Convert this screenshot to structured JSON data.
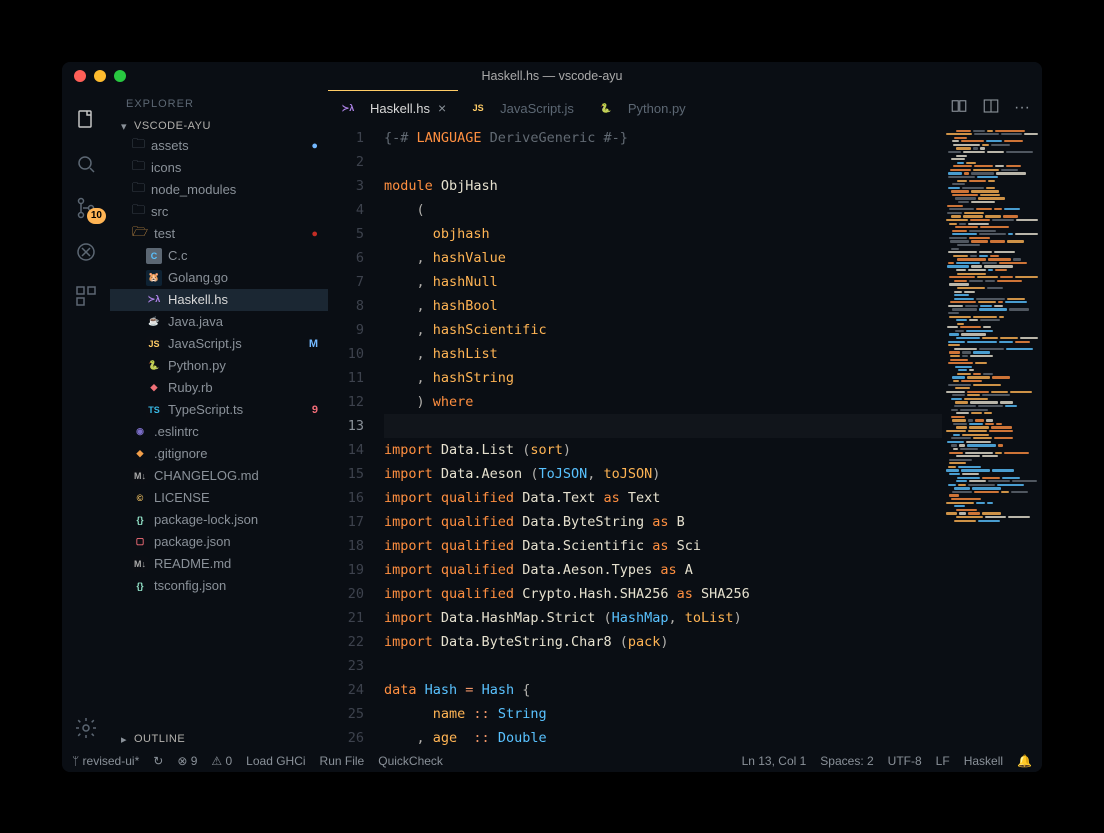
{
  "window": {
    "title": "Haskell.hs — vscode-ayu",
    "traffic_colors": [
      "#ff5f57",
      "#febc2e",
      "#28c840"
    ]
  },
  "activity": {
    "badge_source": "10"
  },
  "sidebar": {
    "title": "EXPLORER",
    "section": "VSCODE-AYU",
    "outline_label": "OUTLINE",
    "items": [
      {
        "kind": "folder",
        "name": "assets",
        "depth": 1,
        "decoration": "●",
        "decColor": "#73b8ff"
      },
      {
        "kind": "folder",
        "name": "icons",
        "depth": 1
      },
      {
        "kind": "folder",
        "name": "node_modules",
        "depth": 1
      },
      {
        "kind": "folder",
        "name": "src",
        "depth": 1
      },
      {
        "kind": "folder",
        "name": "test",
        "depth": 1,
        "open": true,
        "decoration": "●",
        "decColor": "#c42d25",
        "iconColor": "#ffb454"
      },
      {
        "kind": "file",
        "name": "C.c",
        "depth": 2,
        "iconBg": "#5c6773",
        "iconFg": "#59c2ff",
        "iconText": "C"
      },
      {
        "kind": "file",
        "name": "Golang.go",
        "depth": 2,
        "iconBg": "#0e2233",
        "iconFg": "#7fd5ea",
        "iconText": "🐹"
      },
      {
        "kind": "file",
        "name": "Haskell.hs",
        "depth": 2,
        "active": true,
        "iconBg": "transparent",
        "iconFg": "#b084eb",
        "iconText": "≻λ"
      },
      {
        "kind": "file",
        "name": "Java.java",
        "depth": 2,
        "iconBg": "transparent",
        "iconFg": "#e45649",
        "iconText": "☕"
      },
      {
        "kind": "file",
        "name": "JavaScript.js",
        "depth": 2,
        "decoration": "M",
        "decColor": "#73b8ff",
        "iconBg": "#0b0e14",
        "iconFg": "#ffcc66",
        "iconText": "JS"
      },
      {
        "kind": "file",
        "name": "Python.py",
        "depth": 2,
        "iconBg": "transparent",
        "iconFg": "#ffd580",
        "iconText": "🐍"
      },
      {
        "kind": "file",
        "name": "Ruby.rb",
        "depth": 2,
        "iconBg": "transparent",
        "iconFg": "#f07178",
        "iconText": "◆"
      },
      {
        "kind": "file",
        "name": "TypeScript.ts",
        "depth": 2,
        "decoration": "9",
        "decColor": "#f26d78",
        "iconBg": "#0b0e14",
        "iconFg": "#39bae6",
        "iconText": "TS"
      },
      {
        "kind": "file",
        "name": ".eslintrc",
        "depth": 1,
        "iconBg": "transparent",
        "iconFg": "#7b6dc7",
        "iconText": "◉"
      },
      {
        "kind": "file",
        "name": ".gitignore",
        "depth": 1,
        "iconBg": "transparent",
        "iconFg": "#f29e49",
        "iconText": "◆"
      },
      {
        "kind": "file",
        "name": "CHANGELOG.md",
        "depth": 1,
        "iconBg": "#0b0e14",
        "iconFg": "#aaa",
        "iconText": "M↓"
      },
      {
        "kind": "file",
        "name": "LICENSE",
        "depth": 1,
        "iconBg": "transparent",
        "iconFg": "#ffcc66",
        "iconText": "©"
      },
      {
        "kind": "file",
        "name": "package-lock.json",
        "depth": 1,
        "iconBg": "transparent",
        "iconFg": "#95e6cb",
        "iconText": "{}"
      },
      {
        "kind": "file",
        "name": "package.json",
        "depth": 1,
        "iconBg": "transparent",
        "iconFg": "#f26d78",
        "iconText": "▢"
      },
      {
        "kind": "file",
        "name": "README.md",
        "depth": 1,
        "iconBg": "#0b0e14",
        "iconFg": "#aaa",
        "iconText": "M↓"
      },
      {
        "kind": "file",
        "name": "tsconfig.json",
        "depth": 1,
        "iconBg": "transparent",
        "iconFg": "#95e6cb",
        "iconText": "{}"
      }
    ]
  },
  "tabs": [
    {
      "label": "Haskell.hs",
      "active": true,
      "iconText": "≻λ",
      "iconColor": "#b084eb",
      "close": "×"
    },
    {
      "label": "JavaScript.js",
      "iconText": "JS",
      "iconColor": "#ffcc66"
    },
    {
      "label": "Python.py",
      "iconText": "🐍",
      "iconColor": "#ffd580"
    }
  ],
  "code_lines": [
    {
      "n": 1,
      "segs": [
        {
          "t": "{-# ",
          "c": "comment"
        },
        {
          "t": "LANGUAGE",
          "c": "keyword"
        },
        {
          "t": " DeriveGeneric #-}",
          "c": "comment"
        }
      ]
    },
    {
      "n": 2,
      "segs": []
    },
    {
      "n": 3,
      "segs": [
        {
          "t": "module",
          "c": "keyword"
        },
        {
          "t": " ObjHash",
          "c": "module"
        }
      ]
    },
    {
      "n": 4,
      "segs": [
        {
          "t": "    ( ",
          "c": "punct"
        }
      ]
    },
    {
      "n": 5,
      "segs": [
        {
          "t": "      ",
          "c": "punct"
        },
        {
          "t": "objhash",
          "c": "func"
        }
      ]
    },
    {
      "n": 6,
      "segs": [
        {
          "t": "    , ",
          "c": "punct"
        },
        {
          "t": "hashValue",
          "c": "func"
        }
      ]
    },
    {
      "n": 7,
      "segs": [
        {
          "t": "    , ",
          "c": "punct"
        },
        {
          "t": "hashNull",
          "c": "func"
        }
      ]
    },
    {
      "n": 8,
      "segs": [
        {
          "t": "    , ",
          "c": "punct"
        },
        {
          "t": "hashBool",
          "c": "func"
        }
      ]
    },
    {
      "n": 9,
      "segs": [
        {
          "t": "    , ",
          "c": "punct"
        },
        {
          "t": "hashScientific",
          "c": "func"
        }
      ]
    },
    {
      "n": 10,
      "segs": [
        {
          "t": "    , ",
          "c": "punct"
        },
        {
          "t": "hashList",
          "c": "func"
        }
      ]
    },
    {
      "n": 11,
      "segs": [
        {
          "t": "    , ",
          "c": "punct"
        },
        {
          "t": "hashString",
          "c": "func"
        }
      ]
    },
    {
      "n": 12,
      "segs": [
        {
          "t": "    ) ",
          "c": "punct"
        },
        {
          "t": "where",
          "c": "keyword"
        }
      ]
    },
    {
      "n": 13,
      "segs": [],
      "current": true
    },
    {
      "n": 14,
      "segs": [
        {
          "t": "import",
          "c": "keyword"
        },
        {
          "t": " Data.List ",
          "c": "ident"
        },
        {
          "t": "(",
          "c": "punct"
        },
        {
          "t": "sort",
          "c": "func"
        },
        {
          "t": ")",
          "c": "punct"
        }
      ]
    },
    {
      "n": 15,
      "segs": [
        {
          "t": "import",
          "c": "keyword"
        },
        {
          "t": " Data.Aeson ",
          "c": "ident"
        },
        {
          "t": "(",
          "c": "punct"
        },
        {
          "t": "ToJSON",
          "c": "type"
        },
        {
          "t": ", ",
          "c": "punct"
        },
        {
          "t": "toJSON",
          "c": "func"
        },
        {
          "t": ")",
          "c": "punct"
        }
      ]
    },
    {
      "n": 16,
      "segs": [
        {
          "t": "import",
          "c": "keyword"
        },
        {
          "t": " qualified",
          "c": "keyword"
        },
        {
          "t": " Data.Text ",
          "c": "ident"
        },
        {
          "t": "as",
          "c": "keyword"
        },
        {
          "t": " Text",
          "c": "ident"
        }
      ]
    },
    {
      "n": 17,
      "segs": [
        {
          "t": "import",
          "c": "keyword"
        },
        {
          "t": " qualified",
          "c": "keyword"
        },
        {
          "t": " Data.ByteString ",
          "c": "ident"
        },
        {
          "t": "as",
          "c": "keyword"
        },
        {
          "t": " B",
          "c": "ident"
        }
      ]
    },
    {
      "n": 18,
      "segs": [
        {
          "t": "import",
          "c": "keyword"
        },
        {
          "t": " qualified",
          "c": "keyword"
        },
        {
          "t": " Data.Scientific ",
          "c": "ident"
        },
        {
          "t": "as",
          "c": "keyword"
        },
        {
          "t": " Sci",
          "c": "ident"
        }
      ]
    },
    {
      "n": 19,
      "segs": [
        {
          "t": "import",
          "c": "keyword"
        },
        {
          "t": " qualified",
          "c": "keyword"
        },
        {
          "t": " Data.Aeson.Types ",
          "c": "ident"
        },
        {
          "t": "as",
          "c": "keyword"
        },
        {
          "t": " A",
          "c": "ident"
        }
      ]
    },
    {
      "n": 20,
      "segs": [
        {
          "t": "import",
          "c": "keyword"
        },
        {
          "t": " qualified",
          "c": "keyword"
        },
        {
          "t": " Crypto.Hash.SHA256 ",
          "c": "ident"
        },
        {
          "t": "as",
          "c": "keyword"
        },
        {
          "t": " SHA256",
          "c": "ident"
        }
      ]
    },
    {
      "n": 21,
      "segs": [
        {
          "t": "import",
          "c": "keyword"
        },
        {
          "t": " Data.HashMap.Strict ",
          "c": "ident"
        },
        {
          "t": "(",
          "c": "punct"
        },
        {
          "t": "HashMap",
          "c": "type"
        },
        {
          "t": ", ",
          "c": "punct"
        },
        {
          "t": "toList",
          "c": "func"
        },
        {
          "t": ")",
          "c": "punct"
        }
      ]
    },
    {
      "n": 22,
      "segs": [
        {
          "t": "import",
          "c": "keyword"
        },
        {
          "t": " Data.ByteString.Char8 ",
          "c": "ident"
        },
        {
          "t": "(",
          "c": "punct"
        },
        {
          "t": "pack",
          "c": "func"
        },
        {
          "t": ")",
          "c": "punct"
        }
      ]
    },
    {
      "n": 23,
      "segs": []
    },
    {
      "n": 24,
      "segs": [
        {
          "t": "data",
          "c": "keyword"
        },
        {
          "t": " ",
          "c": "ident"
        },
        {
          "t": "Hash",
          "c": "type"
        },
        {
          "t": " = ",
          "c": "op"
        },
        {
          "t": "Hash",
          "c": "type"
        },
        {
          "t": " {",
          "c": "punct"
        }
      ]
    },
    {
      "n": 25,
      "segs": [
        {
          "t": "      ",
          "c": "punct"
        },
        {
          "t": "name",
          "c": "func"
        },
        {
          "t": " :: ",
          "c": "op"
        },
        {
          "t": "String",
          "c": "type"
        }
      ]
    },
    {
      "n": 26,
      "segs": [
        {
          "t": "    , ",
          "c": "punct"
        },
        {
          "t": "age",
          "c": "func"
        },
        {
          "t": "  :: ",
          "c": "op"
        },
        {
          "t": "Double",
          "c": "type"
        }
      ]
    }
  ],
  "status": {
    "branch": "revised-ui*",
    "sync_icon": "↻",
    "errors": "9",
    "warnings": "0",
    "action1": "Load GHCi",
    "action2": "Run File",
    "action3": "QuickCheck",
    "cursor": "Ln 13, Col 1",
    "spaces": "Spaces: 2",
    "encoding": "UTF-8",
    "eol": "LF",
    "lang": "Haskell"
  }
}
